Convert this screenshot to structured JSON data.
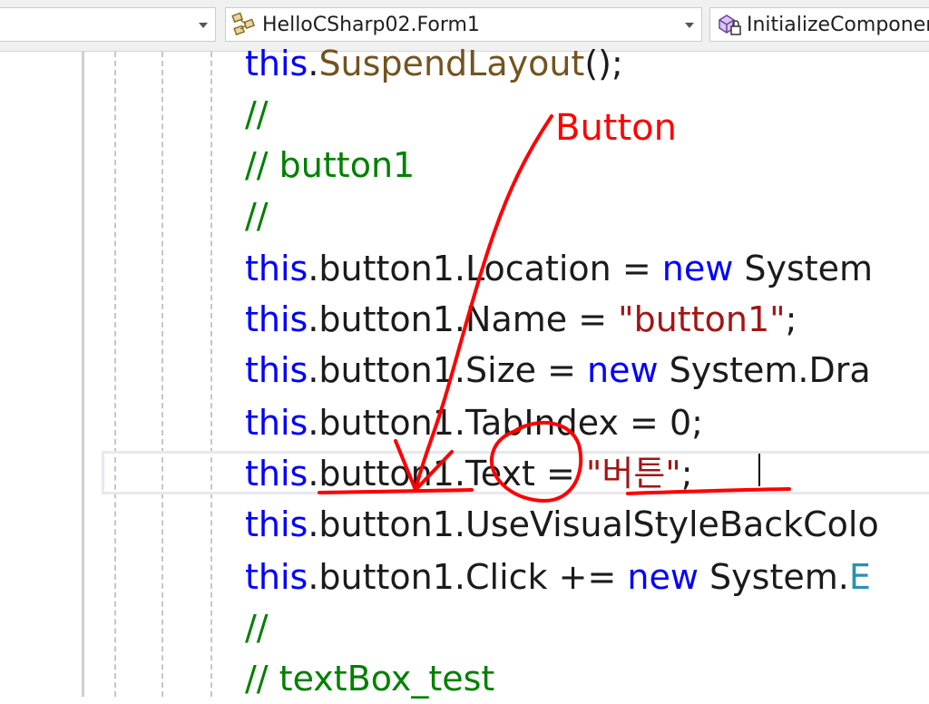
{
  "navbar": {
    "left_combo": "",
    "class_combo": "HelloCSharp02.Form1",
    "member_combo": "InitializeComponent"
  },
  "code": {
    "l1": {
      "this": "this",
      "dot": ".",
      "method": "SuspendLayout",
      "rest": "();"
    },
    "l2": {
      "comment": "//"
    },
    "l3": {
      "comment": "// button1"
    },
    "l4": {
      "comment": "//"
    },
    "l5": {
      "this": "this",
      "mid": ".button1.Location = ",
      "kw": "new",
      "rest": " System"
    },
    "l6": {
      "this": "this",
      "mid": ".button1.Name = ",
      "str": "\"button1\"",
      "rest": ";"
    },
    "l7": {
      "this": "this",
      "mid": ".button1.Size = ",
      "kw": "new",
      "rest": " System.Dra"
    },
    "l8": {
      "this": "this",
      "mid": ".button1.TabIndex = 0;"
    },
    "l9": {
      "this": "this",
      "mid": ".button1.Text = ",
      "str": "\"버튼\"",
      "rest": ";"
    },
    "l10": {
      "this": "this",
      "mid": ".button1.UseVisualStyleBackColo"
    },
    "l11": {
      "this": "this",
      "mid": ".button1.Click += ",
      "kw": "new",
      "rest": " System.",
      "type": "E"
    },
    "l12": {
      "comment": "//"
    },
    "l13": {
      "comment": "// textBox_test"
    }
  },
  "annotation": {
    "label": "Button",
    "color": "#ff0000"
  },
  "colors": {
    "keyword": "#0000ff",
    "comment": "#008000",
    "string": "#a31515",
    "method": "#74531f",
    "type": "#2b91af"
  }
}
